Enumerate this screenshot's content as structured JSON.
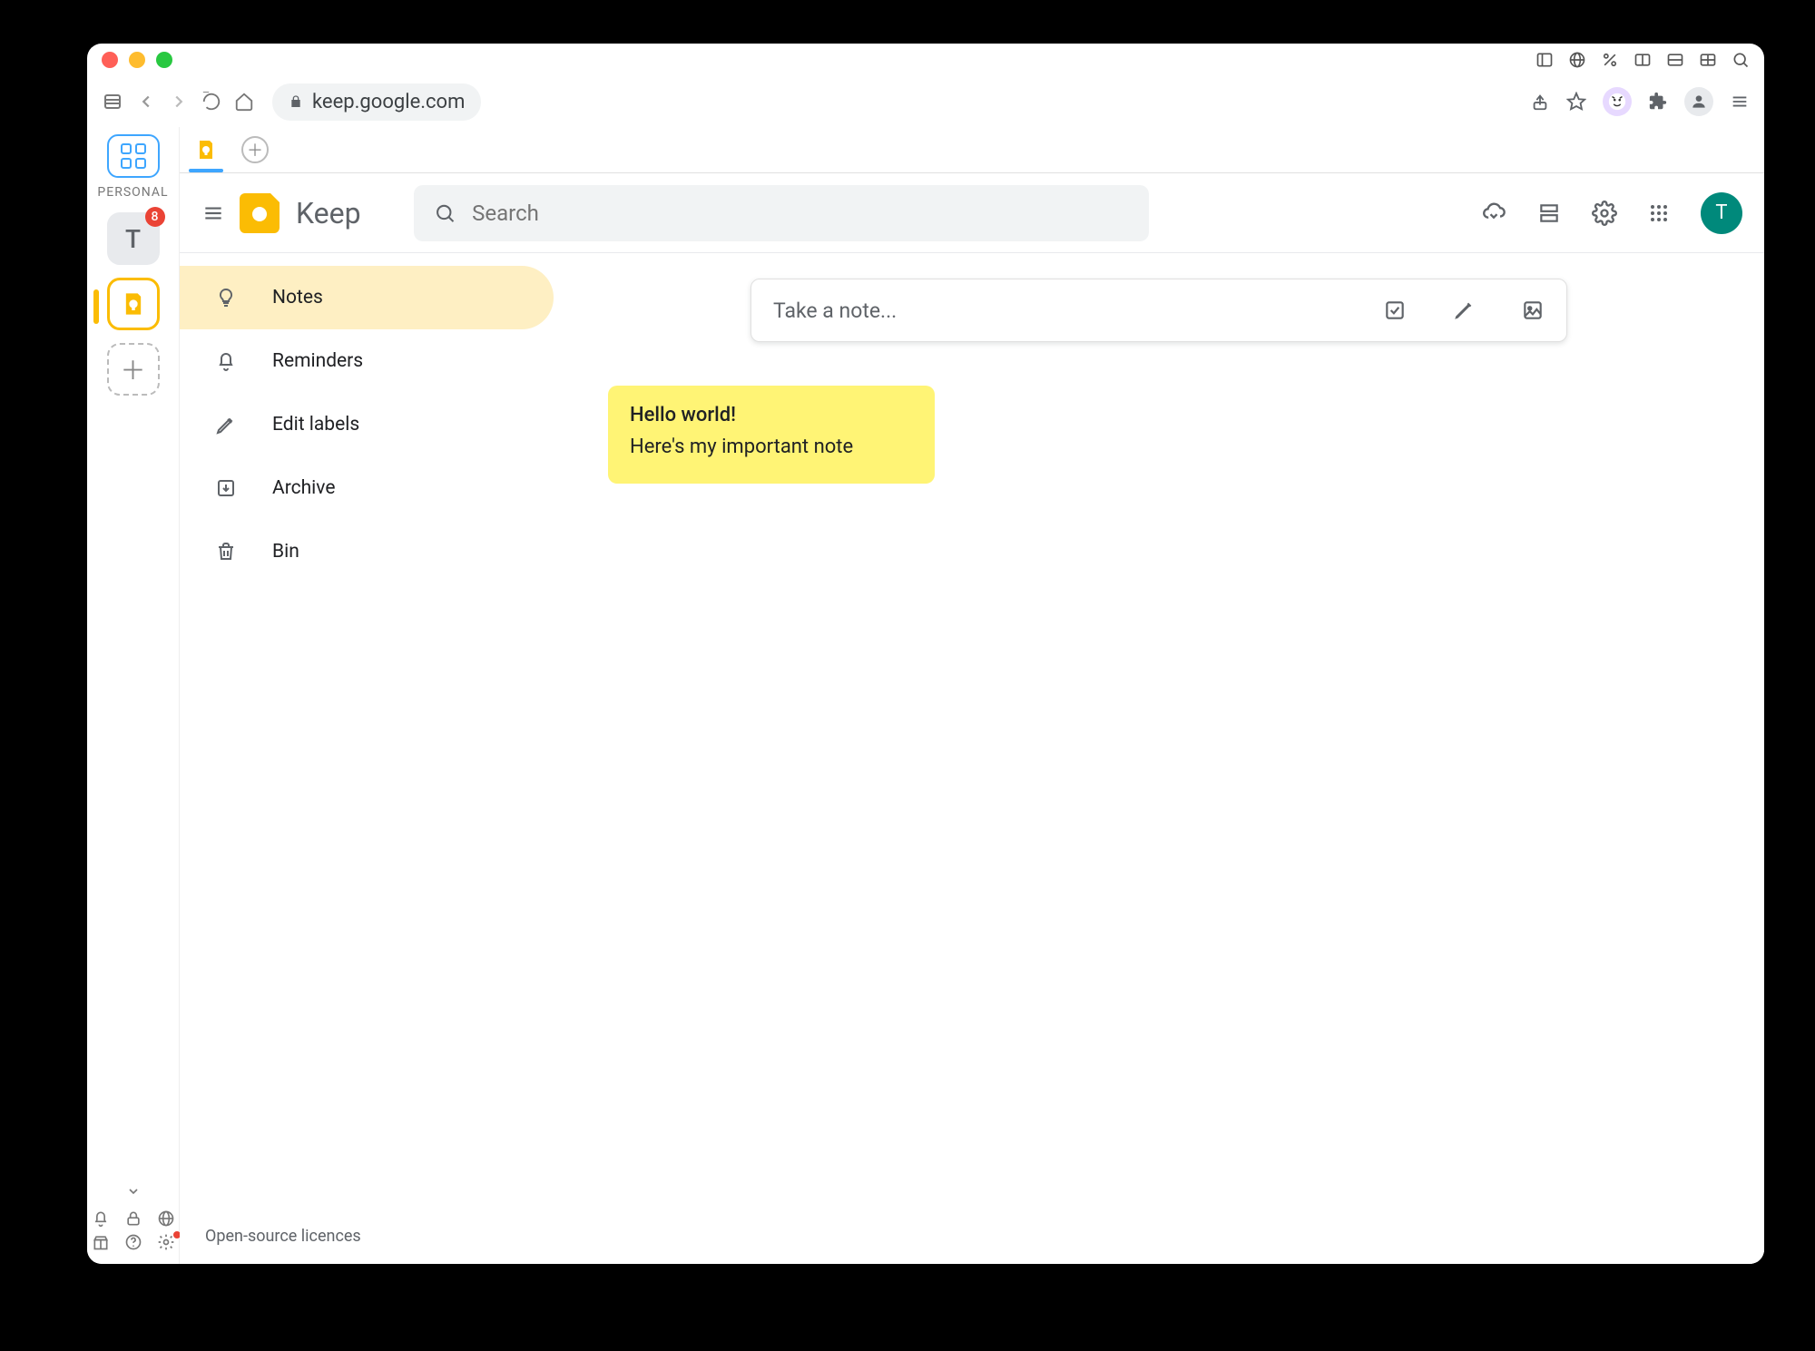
{
  "browser": {
    "url_display": "keep.google.com",
    "extension_cat_bg": "#e7d9ff"
  },
  "left_rail": {
    "section_label": "PERSONAL",
    "items": [
      {
        "letter": "T",
        "badge": "8"
      }
    ]
  },
  "keep": {
    "app_name": "Keep",
    "search_placeholder": "Search",
    "nav": [
      {
        "icon": "lightbulb",
        "label": "Notes",
        "active": true
      },
      {
        "icon": "bell",
        "label": "Reminders",
        "active": false
      },
      {
        "icon": "pencil",
        "label": "Edit labels",
        "active": false
      },
      {
        "icon": "archive",
        "label": "Archive",
        "active": false
      },
      {
        "icon": "trash",
        "label": "Bin",
        "active": false
      }
    ],
    "take_note_placeholder": "Take a note...",
    "avatar_letter": "T",
    "notes": [
      {
        "title": "Hello world!",
        "body": "Here's my important note",
        "color": "#fff475"
      }
    ],
    "footer_link": "Open-source licences"
  }
}
